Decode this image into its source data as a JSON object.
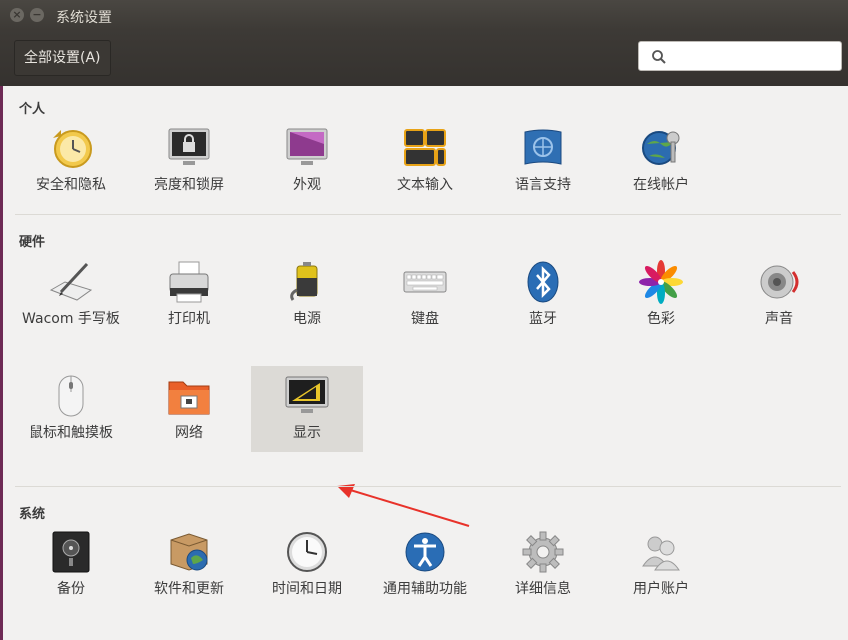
{
  "window": {
    "title": "系统设置"
  },
  "toolbar": {
    "all_settings_label": "全部设置(A)",
    "search_placeholder": ""
  },
  "sections": {
    "personal": {
      "title": "个人",
      "items": [
        "安全和隐私",
        "亮度和锁屏",
        "外观",
        "文本输入",
        "语言支持",
        "在线帐户"
      ]
    },
    "hardware": {
      "title": "硬件",
      "items": [
        "Wacom 手写板",
        "打印机",
        "电源",
        "键盘",
        "蓝牙",
        "色彩",
        "声音",
        "鼠标和触摸板",
        "网络",
        "显示"
      ]
    },
    "system": {
      "title": "系统",
      "items": [
        "备份",
        "软件和更新",
        "时间和日期",
        "通用辅助功能",
        "详细信息",
        "用户账户"
      ]
    }
  },
  "selected_item": "显示",
  "colors": {
    "titlebar": "#3d3a36",
    "accent_arrow": "#e8322a",
    "left_edge": "#6e2a55"
  }
}
